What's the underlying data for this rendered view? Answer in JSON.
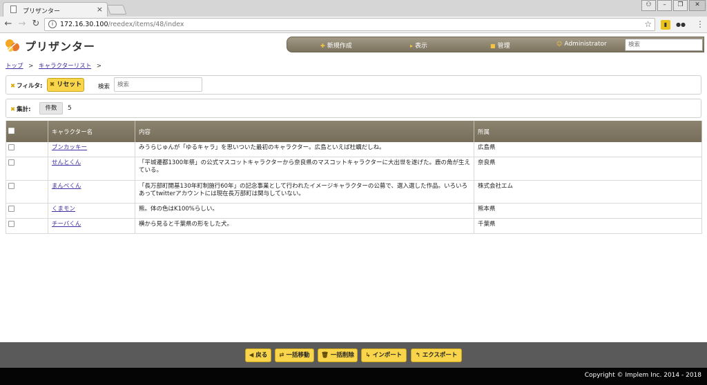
{
  "browser": {
    "tab_title": "プリザンター",
    "url_host": "172.16.30.100",
    "url_path": "/reedex/items/48/index"
  },
  "app": {
    "name": "プリザンター",
    "nav": [
      {
        "label": "新規作成",
        "icon": "plus-icon"
      },
      {
        "label": "表示",
        "icon": "arrow-right-icon"
      },
      {
        "label": "管理",
        "icon": "gear-icon"
      },
      {
        "label": "Administrator",
        "icon": "user-icon"
      }
    ],
    "search_placeholder": "検索"
  },
  "breadcrumb": {
    "top": "トップ",
    "list": "キャラクターリスト",
    "sep": ">"
  },
  "filter": {
    "label": "フィルタ:",
    "reset_label": "リセット",
    "search_label": "検索",
    "search_placeholder": "検索"
  },
  "summary": {
    "label": "集計:",
    "count_label": "件数",
    "count_value": "5"
  },
  "table": {
    "headers": [
      "キャラクター名",
      "内容",
      "所属"
    ],
    "rows": [
      {
        "name": "ブンカッキー",
        "content": "みうらじゅんが「ゆるキャラ」を思いついた最初のキャラクター。広島といえば杜蠣だしね。",
        "org": "広島県"
      },
      {
        "name": "せんとくん",
        "content": "「平城遷都1300年祭」の公式マスコットキャラクターから奈良県のマスコットキャラクターに大出世を遂げた。鹿の角が生えている。",
        "org": "奈良県"
      },
      {
        "name": "まんべくん",
        "content": "「長万部町開基130年町制施行60年」の記念事業として行われたイメージキャラクターの公募で、選入選した作品。いろいろあってtwitterアカウントには現在長万部町は関与していない。",
        "org": "株式会社エム"
      },
      {
        "name": "くまモン",
        "content": "熊。体の色はK100%らしい。",
        "org": "熊本県"
      },
      {
        "name": "チーバくん",
        "content": "横から見ると千葉県の形をした犬。",
        "org": "千葉県"
      }
    ]
  },
  "actions": [
    {
      "label": "戻る",
      "icon": "back-icon"
    },
    {
      "label": "一括移動",
      "icon": "move-icon"
    },
    {
      "label": "一括削除",
      "icon": "trash-icon"
    },
    {
      "label": "インポート",
      "icon": "import-icon"
    },
    {
      "label": "エクスポート",
      "icon": "export-icon"
    }
  ],
  "copyright": "Copyright © Implem Inc. 2014 - 2018"
}
